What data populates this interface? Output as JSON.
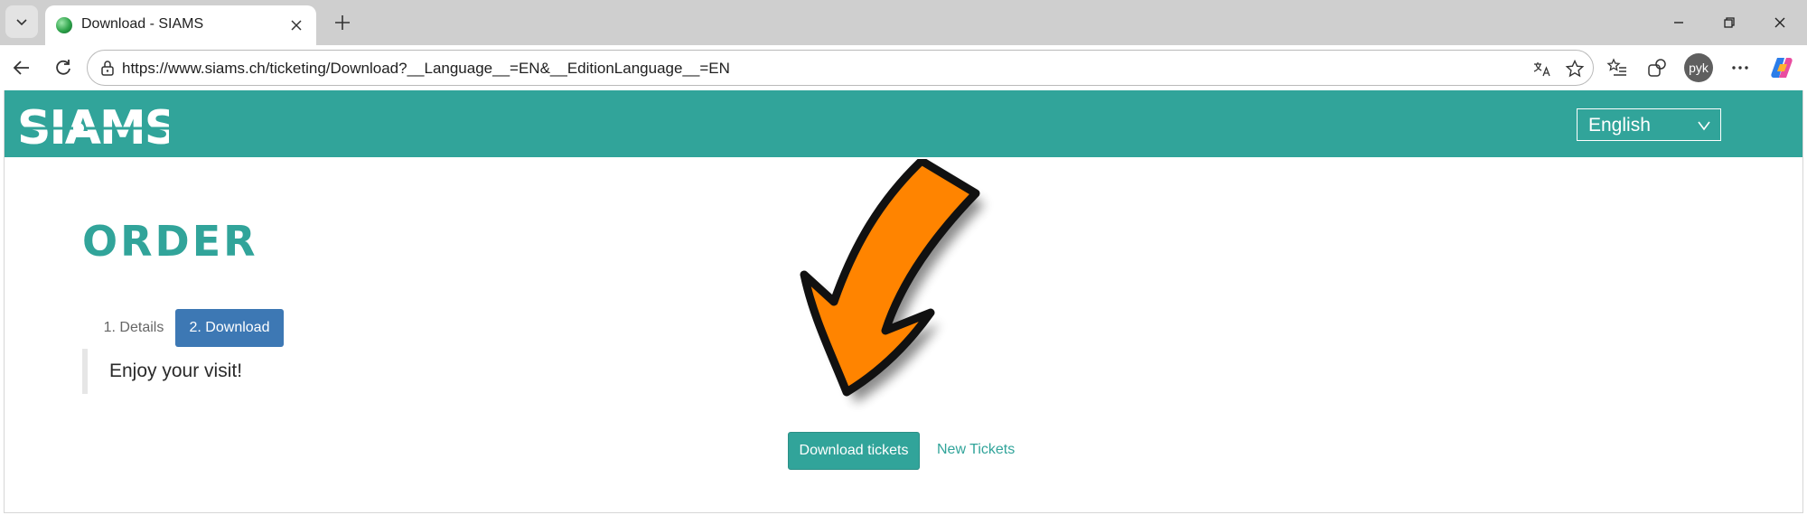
{
  "browser": {
    "tab": {
      "title": "Download - SIAMS"
    },
    "address_bar": {
      "url": "https://www.siams.ch/ticketing/Download?__Language__=EN&__EditionLanguage__=EN"
    },
    "profile": {
      "initials": "pyk"
    }
  },
  "site": {
    "logo_text": "SIAMS",
    "language_select": {
      "value": "English"
    },
    "brand_color": "#31a49a"
  },
  "main": {
    "title": "ORDER",
    "steps": [
      {
        "label": "1. Details",
        "active": false
      },
      {
        "label": "2. Download",
        "active": true
      }
    ],
    "message": "Enjoy your visit!",
    "download_button": "Download tickets",
    "new_tickets_link": "New Tickets"
  },
  "overlay": {
    "arrow_color": "#ff8400"
  }
}
